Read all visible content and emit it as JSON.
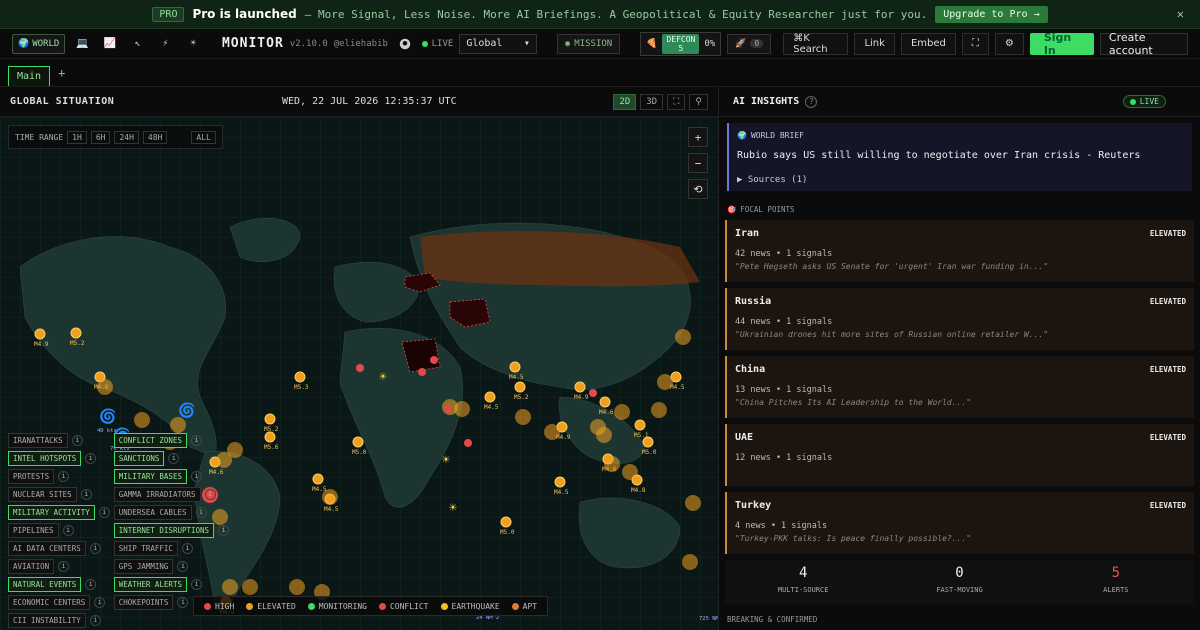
{
  "promo": {
    "badge": "PRO",
    "headline": "Pro is launched",
    "description": "— More Signal, Less Noise. More AI Briefings. A Geopolitical & Equity Researcher just for you.",
    "upgrade_label": "Upgrade to Pro →",
    "close": "✕"
  },
  "topbar": {
    "variants": [
      {
        "icon": "globe-icon",
        "glyph": "🌍",
        "label": "WORLD"
      },
      {
        "icon": "laptop-icon",
        "glyph": "💻",
        "label": ""
      },
      {
        "icon": "chart-icon",
        "glyph": "📈",
        "label": ""
      },
      {
        "icon": "cursor-icon",
        "glyph": "↖",
        "label": ""
      },
      {
        "icon": "bolt-icon",
        "glyph": "⚡",
        "label": ""
      },
      {
        "icon": "sun-icon",
        "glyph": "☀",
        "label": ""
      }
    ],
    "brand": "MONITOR",
    "version": "v2.10.0",
    "author": "@eliehabib",
    "live": "LIVE",
    "region": "Global",
    "mission": "MISSION",
    "defcon_label": "DEFCON",
    "defcon_level": "5",
    "defcon_pct": "0%",
    "alert_count": "0",
    "search": "⌘K  Search",
    "link": "Link",
    "embed": "Embed",
    "signin": "Sign In",
    "create_account": "Create account"
  },
  "tabs": [
    {
      "label": "Main"
    }
  ],
  "map": {
    "title": "GLOBAL SITUATION",
    "datetime": "WED, 22 JUL 2026 12:35:37 UTC",
    "view_modes": [
      "2D",
      "3D"
    ],
    "time_range_label": "TIME RANGE",
    "time_ranges": [
      "1H",
      "6H",
      "24H",
      "48H",
      "ALL"
    ],
    "zoom_in": "+",
    "zoom_out": "−",
    "reset": "⟲",
    "layers": [
      {
        "label": "IRANATTACKS",
        "on": false
      },
      {
        "label": "CONFLICT ZONES",
        "on": true
      },
      {
        "label": "INTEL HOTSPOTS",
        "on": true
      },
      {
        "label": "SANCTIONS",
        "on": true
      },
      {
        "label": "PROTESTS",
        "on": false
      },
      {
        "label": "MILITARY BASES",
        "on": true
      },
      {
        "label": "NUCLEAR SITES",
        "on": false
      },
      {
        "label": "GAMMA IRRADIATORS",
        "on": false
      },
      {
        "label": "MILITARY ACTIVITY",
        "on": true
      },
      {
        "label": "UNDERSEA CABLES",
        "on": false
      },
      {
        "label": "PIPELINES",
        "on": false
      },
      {
        "label": "INTERNET DISRUPTIONS",
        "on": true
      },
      {
        "label": "AI DATA CENTERS",
        "on": false
      },
      {
        "label": "SHIP TRAFFIC",
        "on": false
      },
      {
        "label": "AVIATION",
        "on": false
      },
      {
        "label": "GPS JAMMING",
        "on": false
      },
      {
        "label": "NATURAL EVENTS",
        "on": true
      },
      {
        "label": "WEATHER ALERTS",
        "on": true
      },
      {
        "label": "ECONOMIC CENTERS",
        "on": false
      },
      {
        "label": "CHOKEPOINTS",
        "on": false
      },
      {
        "label": "CII INSTABILITY",
        "on": false
      }
    ],
    "legend": [
      {
        "label": "HIGH",
        "color": "#e24a4a"
      },
      {
        "label": "ELEVATED",
        "color": "#f0a020"
      },
      {
        "label": "MONITORING",
        "color": "#3ddc64"
      },
      {
        "label": "CONFLICT",
        "color": "#e24a4a"
      },
      {
        "label": "EARTHQUAKE",
        "color": "#f0c020"
      },
      {
        "label": "APT",
        "color": "#e07a30"
      }
    ],
    "quake_labels": [
      "M4.9",
      "M5.2",
      "M4.6",
      "M5.3",
      "M5.2",
      "M5.6",
      "M4.6",
      "M4.5",
      "M5.0",
      "M4.5",
      "M5.0",
      "M5.2",
      "M4.9",
      "M4.5",
      "M4.5",
      "M4.6",
      "M5.1",
      "M4.8",
      "M4.6",
      "M4.5",
      "M5.0",
      "M4.9",
      "M4.5",
      "M4.8"
    ],
    "storm_labels": [
      "40 kts",
      "70 kts",
      "24 NM^2",
      "725 NM^2"
    ]
  },
  "insights": {
    "title": "AI INSIGHTS",
    "live": "LIVE",
    "brief_label": "WORLD BRIEF",
    "headline": "Rubio says US still willing to negotiate over Iran crisis - Reuters",
    "sources": "▶ Sources (1)",
    "focal_label": "FOCAL POINTS",
    "focal": [
      {
        "name": "Iran",
        "level": "ELEVATED",
        "stats": "42 news • 1 signals",
        "quote": "\"Pete Hegseth asks US Senate for 'urgent' Iran war funding in...\""
      },
      {
        "name": "Russia",
        "level": "ELEVATED",
        "stats": "44 news • 1 signals",
        "quote": "\"Ukrainian drones hit more sites of Russian online retailer W...\""
      },
      {
        "name": "China",
        "level": "ELEVATED",
        "stats": "13 news • 1 signals",
        "quote": "\"China Pitches Its AI Leadership to the World...\""
      },
      {
        "name": "UAE",
        "level": "ELEVATED",
        "stats": "12 news • 1 signals",
        "quote": ""
      },
      {
        "name": "Turkey",
        "level": "ELEVATED",
        "stats": "4 news • 1 signals",
        "quote": "\"Turkey-PKK talks: Is peace finally possible?...\""
      }
    ],
    "stats": [
      {
        "value": "4",
        "label": "MULTI-SOURCE"
      },
      {
        "value": "0",
        "label": "FAST-MOVING"
      },
      {
        "value": "5",
        "label": "ALERTS"
      }
    ],
    "breaking": "BREAKING & CONFIRMED"
  },
  "colors": {
    "accent": "#3ddc64",
    "elevated": "#f0a020",
    "high": "#e24a4a",
    "brief": "#6a78d8"
  }
}
